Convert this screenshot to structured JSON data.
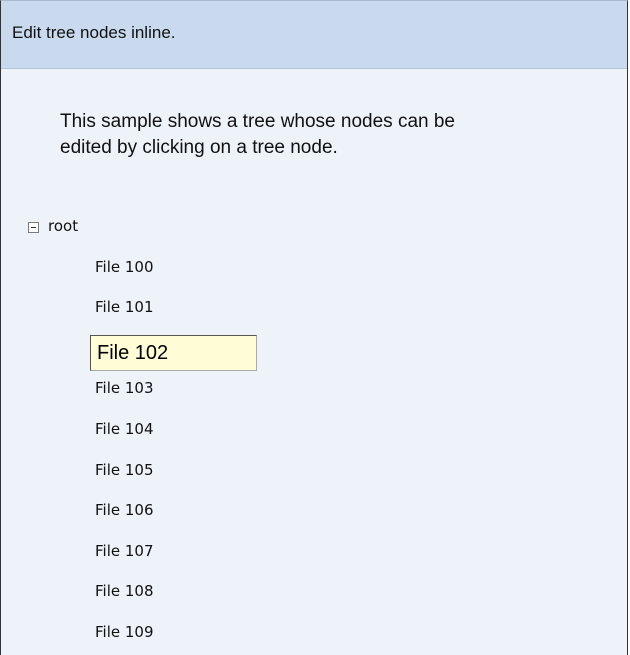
{
  "header": {
    "title": "Edit tree nodes inline."
  },
  "description": {
    "line1": "This sample shows a tree whose nodes can be",
    "line2": "edited by clicking on a tree node."
  },
  "tree": {
    "root": {
      "label": "root",
      "expanded": true,
      "toggle_icon": "collapse-minus-icon"
    },
    "editing_value": "File 102",
    "nodes": [
      {
        "label": "File 100"
      },
      {
        "label": "File 101"
      },
      {
        "label": "File 102",
        "editing": true
      },
      {
        "label": "File 103"
      },
      {
        "label": "File 104"
      },
      {
        "label": "File 105"
      },
      {
        "label": "File 106"
      },
      {
        "label": "File 107"
      },
      {
        "label": "File 108"
      },
      {
        "label": "File 109"
      }
    ]
  },
  "colors": {
    "header_bg": "#c9d9ee",
    "panel_bg": "#eef3fa",
    "edit_bg": "#fffcd6",
    "border": "#333333"
  }
}
